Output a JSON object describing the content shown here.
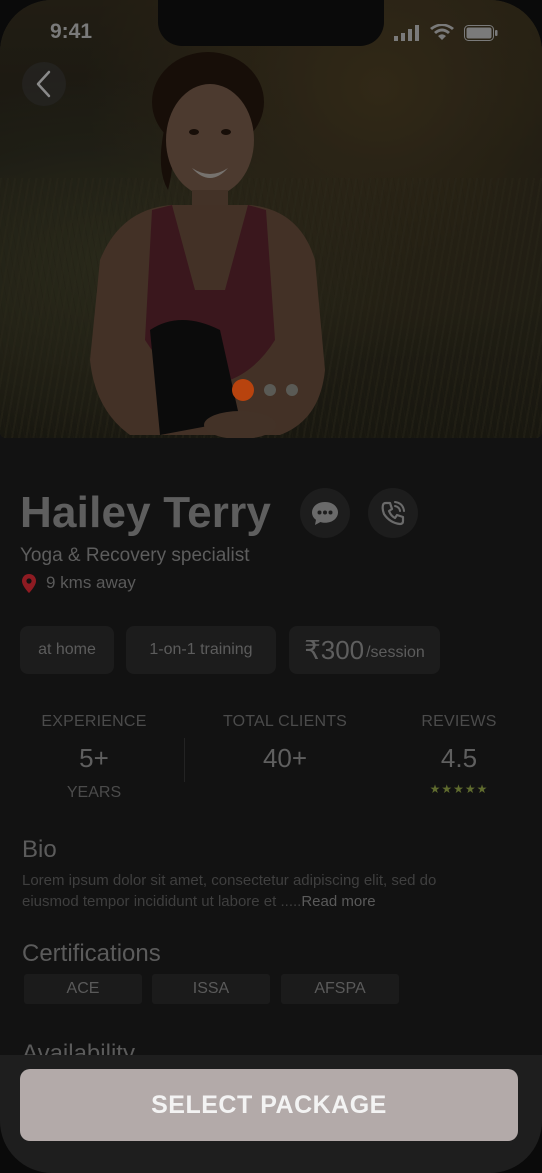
{
  "status": {
    "time": "9:41"
  },
  "carousel": {
    "total": 3,
    "active_index": 0
  },
  "profile": {
    "name": "Hailey Terry",
    "role": "Yoga & Recovery specialist",
    "distance": "9 kms away"
  },
  "chips": {
    "location": "at home",
    "training": "1-on-1 training",
    "price_amount": "₹300",
    "price_unit": "/session"
  },
  "stats": {
    "experience": {
      "label": "EXPERIENCE",
      "value": "5+",
      "unit": "YEARS"
    },
    "clients": {
      "label": "TOTAL CLIENTS",
      "value": "40+"
    },
    "reviews": {
      "label": "REVIEWS",
      "value": "4.5",
      "stars": "★★★★★"
    }
  },
  "bio": {
    "title": "Bio",
    "text": "Lorem ipsum dolor sit amet, consectetur adipiscing elit, sed do eiusmod tempor incididunt ut labore et .....",
    "read_more": "Read more"
  },
  "certifications": {
    "title": "Certifications",
    "items": [
      "ACE",
      "ISSA",
      "AFSPA"
    ]
  },
  "availability": {
    "title": "Availability"
  },
  "cta": {
    "label": "SELECT PACKAGE"
  },
  "colors": {
    "accent": "#b8430e",
    "location_pin": "#8e1b22",
    "cta_bg": "#b3aaa9"
  }
}
